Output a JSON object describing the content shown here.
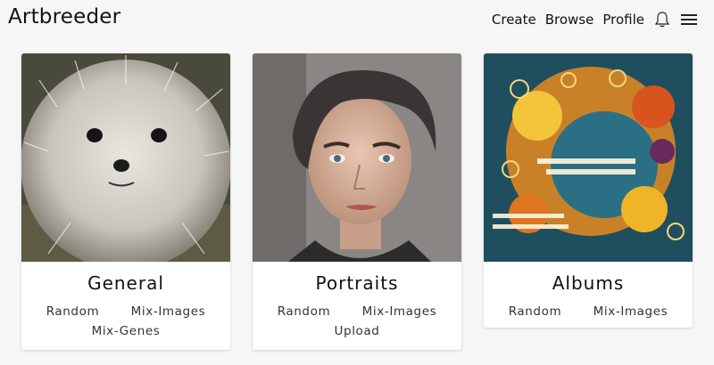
{
  "header": {
    "logo": "Artbreeder",
    "nav": [
      "Create",
      "Browse",
      "Profile"
    ],
    "icons": [
      "bell-icon",
      "hamburger-menu-icon"
    ]
  },
  "cards": [
    {
      "title": "General",
      "links": [
        "Random",
        "Mix-Images",
        "Mix-Genes"
      ],
      "image": "fluffy-white-dog"
    },
    {
      "title": "Portraits",
      "links": [
        "Random",
        "Mix-Images",
        "Upload"
      ],
      "image": "portrait-person-short-hair"
    },
    {
      "title": "Albums",
      "links": [
        "Random",
        "Mix-Images"
      ],
      "image": "abstract-orange-blue-art"
    }
  ],
  "colors": {
    "background": "#f6f6f6",
    "card": "#ffffff",
    "text": "#222222"
  }
}
